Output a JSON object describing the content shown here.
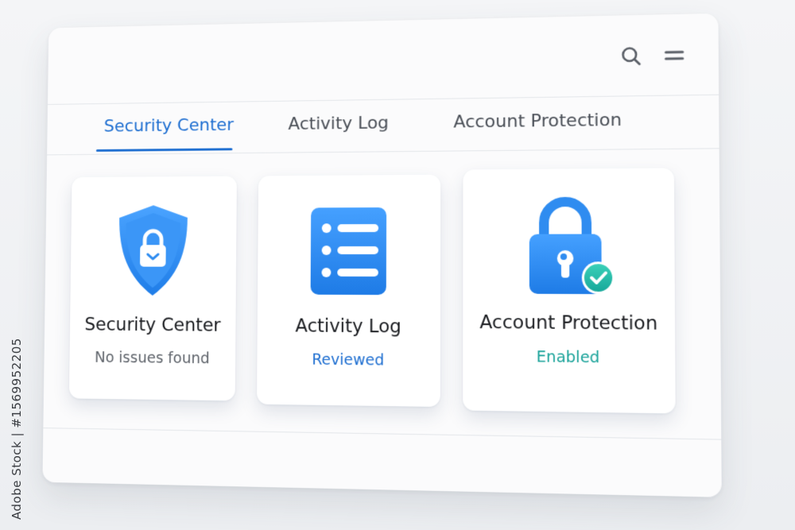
{
  "side_watermark": "Adobe Stock | #1569952205",
  "header": {
    "search_icon": "search-icon",
    "menu_icon": "menu-icon"
  },
  "tabs": [
    {
      "label": "Security Center",
      "active": true
    },
    {
      "label": "Activity Log",
      "active": false
    },
    {
      "label": "Account Protection",
      "active": false
    }
  ],
  "cards": [
    {
      "title": "Security Center",
      "status": "No issues found",
      "status_color": "#5f646b",
      "icon": "shield-lock-icon"
    },
    {
      "title": "Activity Log",
      "status": "Reviewed",
      "status_color": "#1f6fd1",
      "icon": "list-document-icon"
    },
    {
      "title": "Account Protection",
      "status": "Enabled",
      "status_color": "#1aa39a",
      "icon": "padlock-check-icon"
    }
  ],
  "colors": {
    "accent": "#1f6fd1",
    "icon_blue": "#2f8cf0",
    "success_teal": "#1aa39a"
  }
}
